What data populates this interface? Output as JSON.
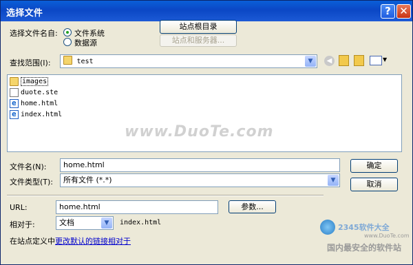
{
  "window": {
    "title": "选择文件"
  },
  "top": {
    "choose_label": "选择文件名自:",
    "radio_filesystem": "文件系统",
    "radio_datasource": "数据源",
    "site_root_button": "站点根目录",
    "site_server_button": "站点和服务器..."
  },
  "lookin": {
    "label": "查找范围(I):",
    "value": "test"
  },
  "files": [
    {
      "name": "images",
      "type": "folder"
    },
    {
      "name": "duote.ste",
      "type": "ste"
    },
    {
      "name": "home.html",
      "type": "html"
    },
    {
      "name": "index.html",
      "type": "html"
    }
  ],
  "watermark": "www.DuoTe.com",
  "filename": {
    "label": "文件名(N):",
    "value": "home.html",
    "ok_button": "确定"
  },
  "filetype": {
    "label": "文件类型(T):",
    "value": "所有文件 (*.*)",
    "cancel_button": "取消"
  },
  "url": {
    "label": "URL:",
    "value": "home.html",
    "params_button": "参数..."
  },
  "relative": {
    "label": "相对于:",
    "value": "文档",
    "file": "index.html"
  },
  "footer": {
    "prefix": "在站点定义中",
    "link": "更改默认的链接相对于"
  },
  "corner_watermark": {
    "brand": "2345软件大全",
    "url": "www.DuoTe.com",
    "slogan": "国内最安全的软件站"
  }
}
